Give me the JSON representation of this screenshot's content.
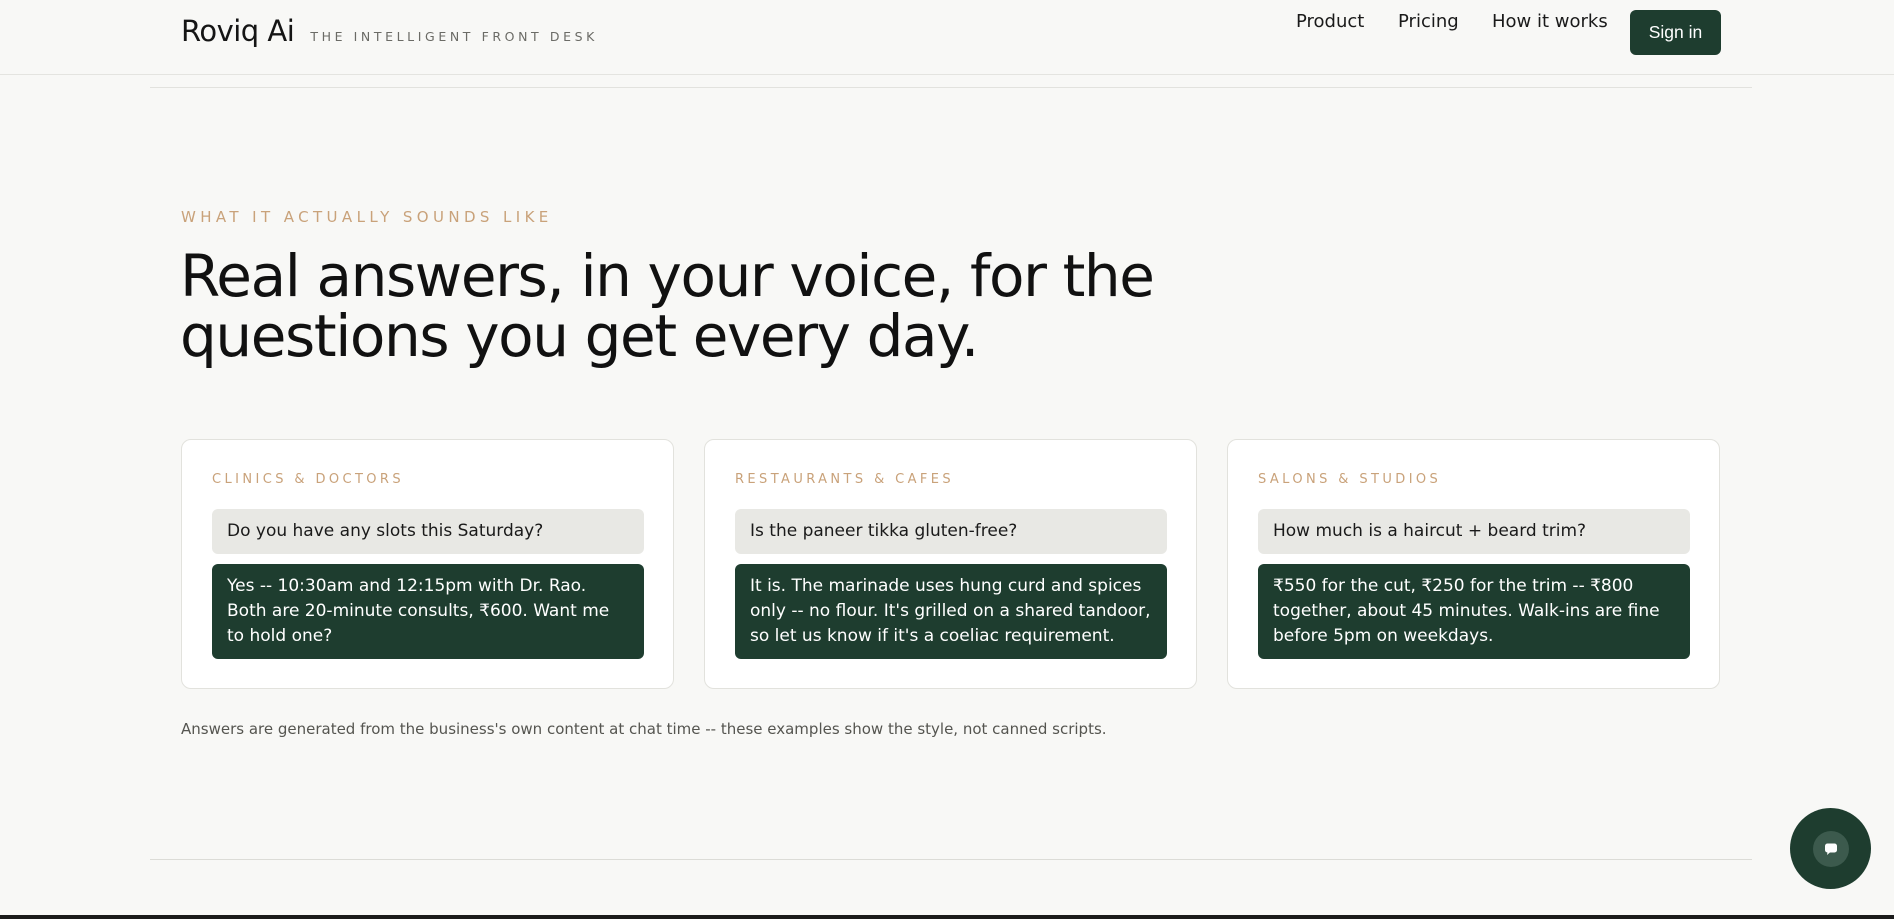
{
  "header": {
    "brand": "Roviq Ai",
    "tagline": "THE INTELLIGENT FRONT DESK",
    "nav": [
      "Product",
      "Pricing",
      "How it works"
    ],
    "signin_label": "Sign in"
  },
  "hero": {
    "eyebrow": "WHAT IT ACTUALLY SOUNDS LIKE",
    "headline_line1": "Real answers, in your voice, for the",
    "headline_line2": "questions you get every day."
  },
  "cards": [
    {
      "label": "CLINICS & DOCTORS",
      "question": "Do you have any slots this Saturday?",
      "answer": "Yes -- 10:30am and 12:15pm with Dr. Rao. Both are 20-minute consults, ₹600. Want me to hold one?"
    },
    {
      "label": "RESTAURANTS & CAFES",
      "question": "Is the paneer tikka gluten-free?",
      "answer": "It is. The marinade uses hung curd and spices only -- no flour. It's grilled on a shared tandoor, so let us know if it's a coeliac requirement."
    },
    {
      "label": "SALONS & STUDIOS",
      "question": "How much is a haircut + beard trim?",
      "answer": "₹550 for the cut, ₹250 for the trim -- ₹800 together, about 45 minutes. Walk-ins are fine before 5pm on weekdays."
    }
  ],
  "note": "Answers are generated from the business's own content at chat time -- these examples show the style, not canned scripts.",
  "icons": {
    "chat": "chat-bubble-icon"
  },
  "colors": {
    "accent": "#1e3d2f",
    "eyebrow": "#c9a27a",
    "background": "#f8f8f6"
  }
}
